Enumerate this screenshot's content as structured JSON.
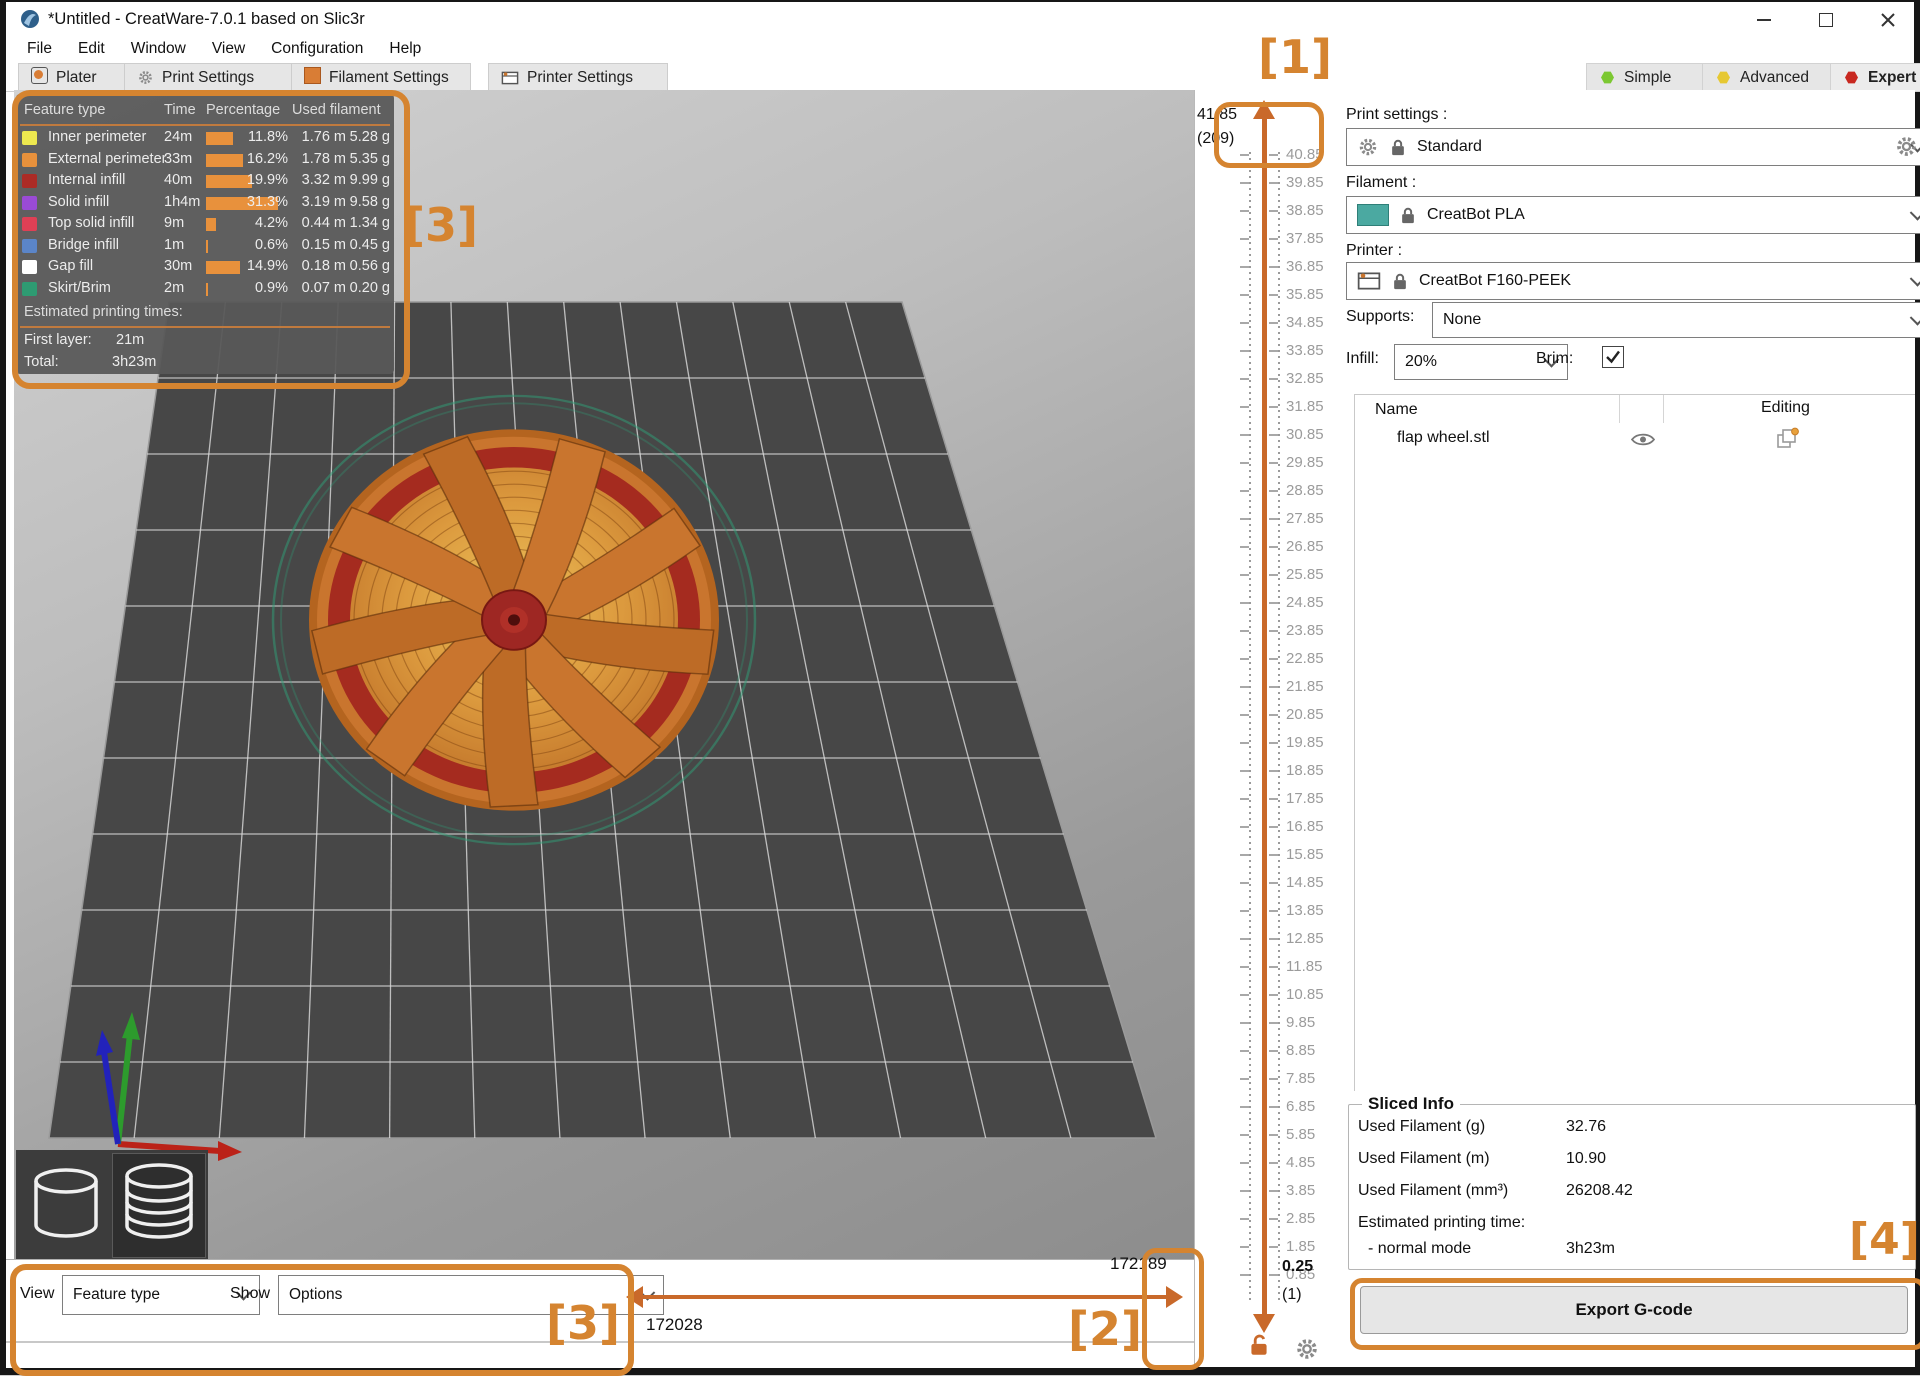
{
  "window": {
    "title": "*Untitled - CreatWare-7.0.1 based on Slic3r",
    "controls": [
      {
        "name": "minimize-button"
      },
      {
        "name": "maximize-button"
      },
      {
        "name": "close-button"
      }
    ]
  },
  "menu": {
    "items": [
      "File",
      "Edit",
      "Window",
      "View",
      "Configuration",
      "Help"
    ]
  },
  "toolbar": {
    "tabs": [
      {
        "label": "Plater",
        "icon": "plater-icon"
      },
      {
        "label": "Print Settings",
        "icon": "gear-icon"
      },
      {
        "label": "Filament Settings",
        "icon": "filament-icon"
      },
      {
        "label": "Printer Settings",
        "icon": "printer-icon"
      }
    ],
    "modes": [
      {
        "label": "Simple",
        "color": "#7cc832",
        "active": false
      },
      {
        "label": "Advanced",
        "color": "#e6c832",
        "active": false
      },
      {
        "label": "Expert",
        "color": "#c82820",
        "active": true
      }
    ]
  },
  "feature_panel": {
    "headers": {
      "feature": "Feature type",
      "time": "Time",
      "percentage": "Percentage",
      "used": "Used filament"
    },
    "rows": [
      {
        "color": "#ede84f",
        "label": "Inner perimeter",
        "time": "24m",
        "pct": 11.8,
        "pct_label": "11.8%",
        "m": "1.76 m",
        "g": "5.28 g"
      },
      {
        "color": "#e8913c",
        "label": "External perimeter",
        "time": "33m",
        "pct": 16.2,
        "pct_label": "16.2%",
        "m": "1.78 m",
        "g": "5.35 g"
      },
      {
        "color": "#ac2b26",
        "label": "Internal infill",
        "time": "40m",
        "pct": 19.9,
        "pct_label": "19.9%",
        "m": "3.32 m",
        "g": "9.99 g"
      },
      {
        "color": "#9a4bd5",
        "label": "Solid infill",
        "time": "1h4m",
        "pct": 31.3,
        "pct_label": "31.3%",
        "m": "3.19 m",
        "g": "9.58 g"
      },
      {
        "color": "#df4055",
        "label": "Top solid infill",
        "time": "9m",
        "pct": 4.2,
        "pct_label": "4.2%",
        "m": "0.44 m",
        "g": "1.34 g"
      },
      {
        "color": "#5b85c8",
        "label": "Bridge infill",
        "time": "1m",
        "pct": 0.6,
        "pct_label": "0.6%",
        "m": "0.15 m",
        "g": "0.45 g"
      },
      {
        "color": "#ffffff",
        "label": "Gap fill",
        "time": "30m",
        "pct": 14.9,
        "pct_label": "14.9%",
        "m": "0.18 m",
        "g": "0.56 g"
      },
      {
        "color": "#2e9b72",
        "label": "Skirt/Brim",
        "time": "2m",
        "pct": 0.9,
        "pct_label": "0.9%",
        "m": "0.07 m",
        "g": "0.20 g"
      }
    ],
    "estimated_title": "Estimated printing times:",
    "first_layer_label": "First layer:",
    "first_layer_value": "21m",
    "total_label": "Total:",
    "total_value": "3h23m"
  },
  "layer_slider": {
    "top_value": "41.85",
    "top_count": "(209)",
    "ticks": [
      "40.85",
      "39.85",
      "38.85",
      "37.85",
      "36.85",
      "35.85",
      "34.85",
      "33.85",
      "32.85",
      "31.85",
      "30.85",
      "29.85",
      "28.85",
      "27.85",
      "26.85",
      "25.85",
      "24.85",
      "23.85",
      "22.85",
      "21.85",
      "20.85",
      "19.85",
      "18.85",
      "17.85",
      "16.85",
      "15.85",
      "14.85",
      "13.85",
      "12.85",
      "11.85",
      "10.85",
      "9.85",
      "8.85",
      "7.85",
      "6.85",
      "5.85",
      "4.85",
      "3.85",
      "2.85",
      "1.85",
      "0.85"
    ],
    "bottom_value": "0.25",
    "bottom_count": "(1)"
  },
  "right_panel": {
    "print_settings_label": "Print settings :",
    "print_settings_value": "Standard",
    "filament_label": "Filament :",
    "filament_value": "CreatBot PLA",
    "filament_color": "#4ba9a1",
    "printer_label": "Printer :",
    "printer_value": "CreatBot F160-PEEK",
    "supports_label": "Supports:",
    "supports_value": "None",
    "infill_label": "Infill:",
    "infill_value": "20%",
    "brim_label": "Brim:",
    "brim_checked": true,
    "objects_table": {
      "name_header": "Name",
      "editing_header": "Editing",
      "rows": [
        {
          "name": "flap wheel.stl"
        }
      ]
    },
    "sliced_info": {
      "title": "Sliced Info",
      "rows": [
        {
          "label": "Used Filament (g)",
          "value": "32.76"
        },
        {
          "label": "Used Filament (m)",
          "value": "10.90"
        },
        {
          "label": "Used Filament (mm³)",
          "value": "26208.42"
        }
      ],
      "time_label": "Estimated printing time:",
      "mode_label": "- normal mode",
      "mode_value": "3h23m"
    },
    "export_button": "Export G-code"
  },
  "bottom_bar": {
    "view_label": "View",
    "view_value": "Feature type",
    "show_label": "Show",
    "show_value": "Options",
    "slider_max": "172189",
    "slider_min": "172028"
  },
  "annotations": {
    "a1": "[1]",
    "a2": "[2]",
    "a3": "[3]",
    "a4": "[4]",
    "color": "#d58430"
  },
  "colors": {
    "accent_orange": "#c9692a",
    "bed": "#474747",
    "grid_line": "#dcdcdc",
    "skirt": "#2fa077"
  }
}
